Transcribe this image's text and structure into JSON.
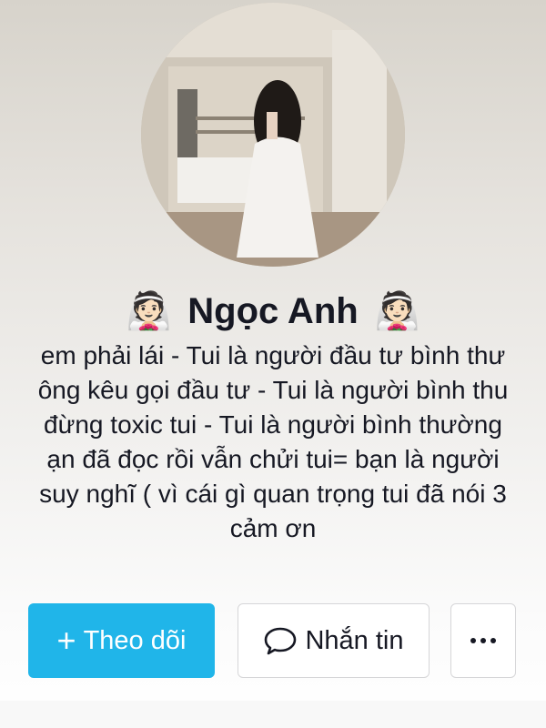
{
  "profile": {
    "name": "Ngọc Anh",
    "name_emoji": "👰🏻",
    "avatar_icon": "profile-photo",
    "bio_lines": [
      "em phải lái - Tui là người đầu tư bình thư",
      "ông kêu gọi đầu tư - Tui là người bình thu",
      "đừng toxic tui - Tui là người bình thường",
      "ạn đã đọc rồi vẫn chửi tui= bạn là người",
      "suy nghĩ ( vì cái gì quan trọng tui đã nói 3",
      "cảm ơn"
    ]
  },
  "actions": {
    "follow_label": "Theo dõi",
    "follow_icon": "plus-icon",
    "message_label": "Nhắn tin",
    "message_icon": "chat-bubble-icon",
    "more_icon": "more-dots-icon"
  },
  "colors": {
    "follow_button": "#20b5e9",
    "text": "#161823",
    "border": "#d6d6d8"
  }
}
